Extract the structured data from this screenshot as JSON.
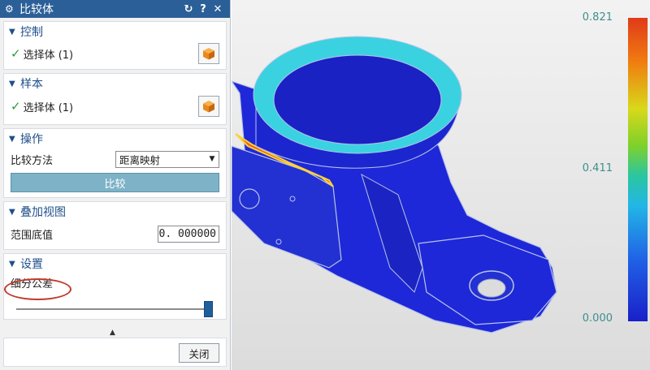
{
  "dialog": {
    "title": "比较体",
    "icons": {
      "gear": "gear-icon",
      "reset": "reset-icon",
      "help": "help-icon",
      "close": "close-icon"
    },
    "help_glyph": "?",
    "close_glyph": "✕"
  },
  "control": {
    "header": "控制",
    "select_label": "选择体 (1)"
  },
  "sample": {
    "header": "样本",
    "select_label": "选择体 (1)"
  },
  "operation": {
    "header": "操作",
    "method_label": "比较方法",
    "method_value": "距离映射",
    "compare_button": "比较"
  },
  "overlay_view": {
    "header": "叠加视图",
    "range_label": "范围底值",
    "range_value": "0. 000000"
  },
  "settings": {
    "header": "设置",
    "tolerance_label": "细分公差",
    "tolerance_level": 1.0
  },
  "footer": {
    "close_button": "关闭"
  },
  "legend": {
    "max": "0.821",
    "mid": "0.411",
    "min": "0.000",
    "colors": [
      "#e03a1a",
      "#f07a10",
      "#d9d81a",
      "#7fd12a",
      "#2bc6a0",
      "#22b6e6",
      "#2060e6",
      "#1a20c8"
    ]
  },
  "colors": {
    "titlebar": "#2b5f98",
    "section_header": "#1f4f8a",
    "compare_button": "#7eb2c6",
    "model_body": "#1e28d8",
    "rim": "#3ad2e0",
    "highlight_ellipse": "#c0392b"
  }
}
